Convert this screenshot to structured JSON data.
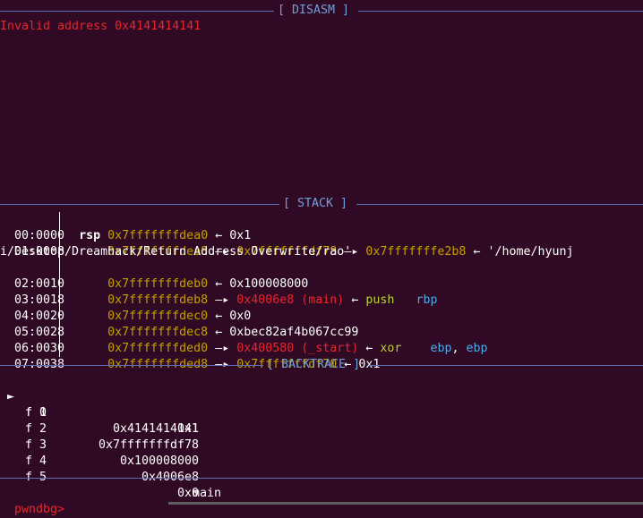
{
  "sections": {
    "disasm": "[ DISASM ]",
    "stack": "[ STACK ]",
    "backtrace": "[ BACKTRACE ]"
  },
  "disasm": {
    "error": "Invalid address 0x4141414141"
  },
  "stack": {
    "rows": [
      {
        "offset": "00:0000",
        "reg": "rsp",
        "addr": "0x7fffffffdea0",
        "a1": "←",
        "v1": "0x1"
      },
      {
        "offset": "01:0008",
        "reg": "",
        "addr": "0x7fffffffdea8",
        "a1": "—▸",
        "v1": "0x7fffffffdf78",
        "a2": "—▸",
        "v2": "0x7fffffffe2b8",
        "a3": "←",
        "v3": "'/home/hyunj",
        "wrap": "i/Desktop/Dreamhack/Return Address Overwrite/rao'"
      },
      {
        "offset": "02:0010",
        "reg": "",
        "addr": "0x7fffffffdeb0",
        "a1": "←",
        "v1": "0x100008000"
      },
      {
        "offset": "03:0018",
        "reg": "",
        "addr": "0x7fffffffdeb8",
        "a1": "—▸",
        "v1": "0x4006e8 (main)",
        "a2": "←",
        "ins": "push",
        "ops": "rbp"
      },
      {
        "offset": "04:0020",
        "reg": "",
        "addr": "0x7fffffffdec0",
        "a1": "←",
        "v1": "0x0"
      },
      {
        "offset": "05:0028",
        "reg": "",
        "addr": "0x7fffffffdec8",
        "a1": "←",
        "v1": "0xbec82af4b067cc99"
      },
      {
        "offset": "06:0030",
        "reg": "",
        "addr": "0x7fffffffded0",
        "a1": "—▸",
        "v1": "0x400580 (_start)",
        "a2": "←",
        "ins": "xor",
        "ops1": "ebp",
        "comma": ",",
        "ops2": "ebp"
      },
      {
        "offset": "07:0038",
        "reg": "",
        "addr": "0x7fffffffded8",
        "a1": "—▸",
        "v1": "0x7fffffffdf70",
        "a2": "←",
        "v2": "0x1"
      }
    ]
  },
  "backtrace": {
    "marker": "►",
    "frames": [
      {
        "label": "f 0",
        "addr": "0x4141414141",
        "sym": ""
      },
      {
        "label": "f 1",
        "addr": "0x1",
        "sym": ""
      },
      {
        "label": "f 2",
        "addr": "0x7fffffffdf78",
        "sym": ""
      },
      {
        "label": "f 3",
        "addr": "0x100008000",
        "sym": ""
      },
      {
        "label": "f 4",
        "addr": "0x4006e8",
        "sym": "main"
      },
      {
        "label": "f 5",
        "addr": "0x0",
        "sym": ""
      }
    ]
  },
  "prompt": "pwndbg>",
  "colors": {
    "background": "#300a24",
    "separator": "#5e6fb5",
    "error": "#e8262e",
    "address": "#c4a000",
    "instruction": "#b5d334",
    "register": "#4ea8e8"
  }
}
